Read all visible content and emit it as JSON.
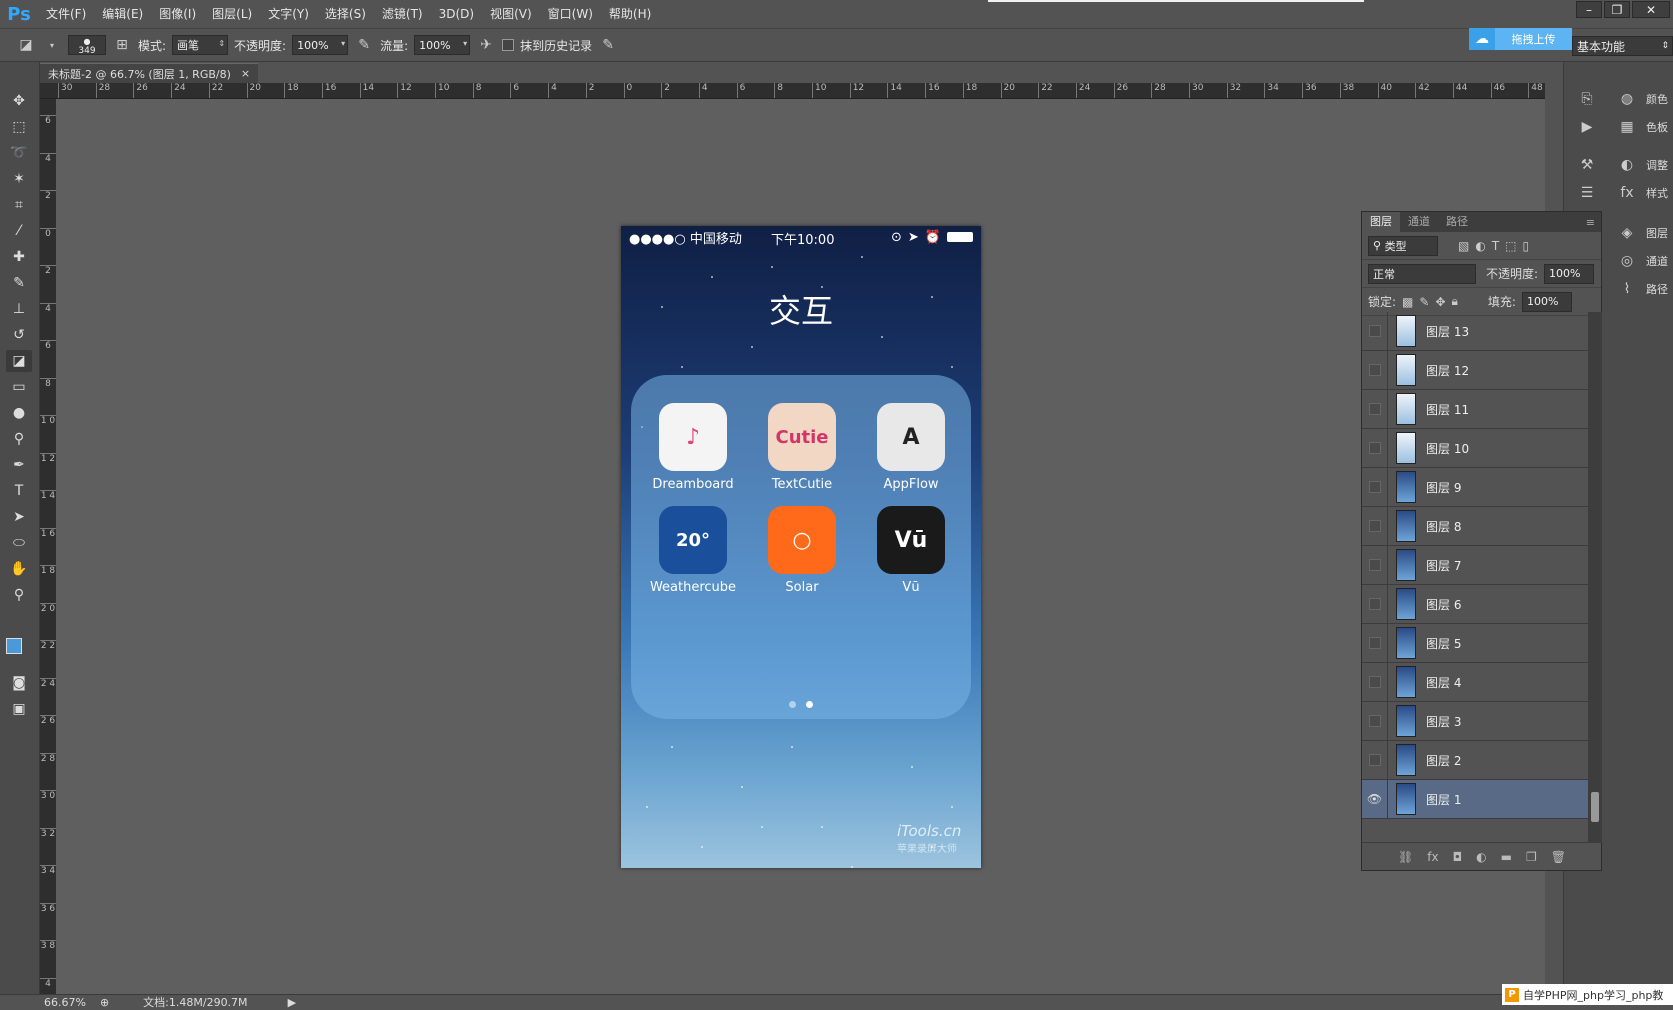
{
  "app": {
    "logo": "Ps"
  },
  "menu": [
    "文件(F)",
    "编辑(E)",
    "图像(I)",
    "图层(L)",
    "文字(Y)",
    "选择(S)",
    "滤镜(T)",
    "3D(D)",
    "视图(V)",
    "窗口(W)",
    "帮助(H)"
  ],
  "window_controls": {
    "minimize": "–",
    "restore": "❐",
    "close": "✕"
  },
  "options": {
    "brush_size": "349",
    "mode_label": "模式:",
    "mode_value": "画笔",
    "opacity_label": "不透明度:",
    "opacity_value": "100%",
    "flow_label": "流量:",
    "flow_value": "100%",
    "history_label": "抹到历史记录"
  },
  "upload": {
    "label": "拖拽上传"
  },
  "workspace": {
    "value": "基本功能"
  },
  "document": {
    "tab_title": "未标题-2 @ 66.7% (图层 1, RGB/8)",
    "close": "×"
  },
  "ruler_h": [
    "30",
    "28",
    "26",
    "24",
    "22",
    "20",
    "18",
    "16",
    "14",
    "12",
    "10",
    "8",
    "6",
    "4",
    "2",
    "0",
    "2",
    "4",
    "6",
    "8",
    "10",
    "12",
    "14",
    "16",
    "18",
    "20",
    "22",
    "24",
    "26",
    "28",
    "30",
    "32",
    "34",
    "36",
    "38",
    "40",
    "42",
    "44",
    "46",
    "48"
  ],
  "ruler_v": [
    "6",
    "4",
    "2",
    "0",
    "2",
    "4",
    "6",
    "8",
    "1 0",
    "1 2",
    "1 4",
    "1 6",
    "1 8",
    "2 0",
    "2 2",
    "2 4",
    "2 6",
    "2 8",
    "3 0",
    "3 2",
    "3 4",
    "3 6",
    "3 8",
    "4"
  ],
  "phone": {
    "carrier": "●●●●○ 中国移动",
    "time": "下午10:00",
    "folder_title": "交互",
    "apps": [
      {
        "name": "Dreamboard",
        "glyph": "♪",
        "bg": "#f4f4f4",
        "fg": "#e0457a"
      },
      {
        "name": "TextCutie",
        "glyph": "Cutie",
        "bg": "#f2d7c4",
        "fg": "#d0366a"
      },
      {
        "name": "AppFlow",
        "glyph": "A",
        "bg": "#e8e8e8",
        "fg": "#222222"
      },
      {
        "name": "Weathercube",
        "glyph": "20°",
        "bg": "#1a4f9c",
        "fg": "#ffffff"
      },
      {
        "name": "Solar",
        "glyph": "○",
        "bg": "#ff6a1a",
        "fg": "#ffffff"
      },
      {
        "name": "Vū",
        "glyph": "Vū",
        "bg": "#1a1a1a",
        "fg": "#ffffff"
      }
    ],
    "watermark": "iTools.cn",
    "watermark_sub": "苹果录屏大师"
  },
  "dock": [
    {
      "label": "颜色",
      "icon": "palette-icon",
      "glyph": "◍"
    },
    {
      "label": "色板",
      "icon": "swatches-icon",
      "glyph": "▦"
    },
    {
      "label": "调整",
      "icon": "adjustments-icon",
      "glyph": "◐"
    },
    {
      "label": "样式",
      "icon": "styles-icon",
      "glyph": "fx"
    },
    {
      "label": "图层",
      "icon": "layers-icon",
      "glyph": "◈"
    },
    {
      "label": "通道",
      "icon": "channels-icon",
      "glyph": "◎"
    },
    {
      "label": "路径",
      "icon": "paths-icon",
      "glyph": "⌇"
    }
  ],
  "layers_panel": {
    "tabs": [
      "图层",
      "通道",
      "路径"
    ],
    "filter_label": "类型",
    "blend_mode": "正常",
    "opacity_label": "不透明度:",
    "opacity_value": "100%",
    "lock_label": "锁定:",
    "fill_label": "填充:",
    "fill_value": "100%",
    "layers": [
      {
        "name": "图层 13",
        "light": true,
        "visible": false
      },
      {
        "name": "图层 12",
        "light": true,
        "visible": false
      },
      {
        "name": "图层 11",
        "light": true,
        "visible": false
      },
      {
        "name": "图层 10",
        "light": true,
        "visible": false
      },
      {
        "name": "图层 9",
        "light": false,
        "visible": false
      },
      {
        "name": "图层 8",
        "light": false,
        "visible": false
      },
      {
        "name": "图层 7",
        "light": false,
        "visible": false
      },
      {
        "name": "图层 6",
        "light": false,
        "visible": false
      },
      {
        "name": "图层 5",
        "light": false,
        "visible": false
      },
      {
        "name": "图层 4",
        "light": false,
        "visible": false
      },
      {
        "name": "图层 3",
        "light": false,
        "visible": false
      },
      {
        "name": "图层 2",
        "light": false,
        "visible": false
      },
      {
        "name": "图层 1",
        "light": false,
        "visible": true
      }
    ]
  },
  "statusbar": {
    "zoom": "66.67%",
    "doc_info": "文档:1.48M/290.7M"
  },
  "php_watermark": {
    "icon": "P",
    "text": "自学PHP网_php学习_php教"
  }
}
